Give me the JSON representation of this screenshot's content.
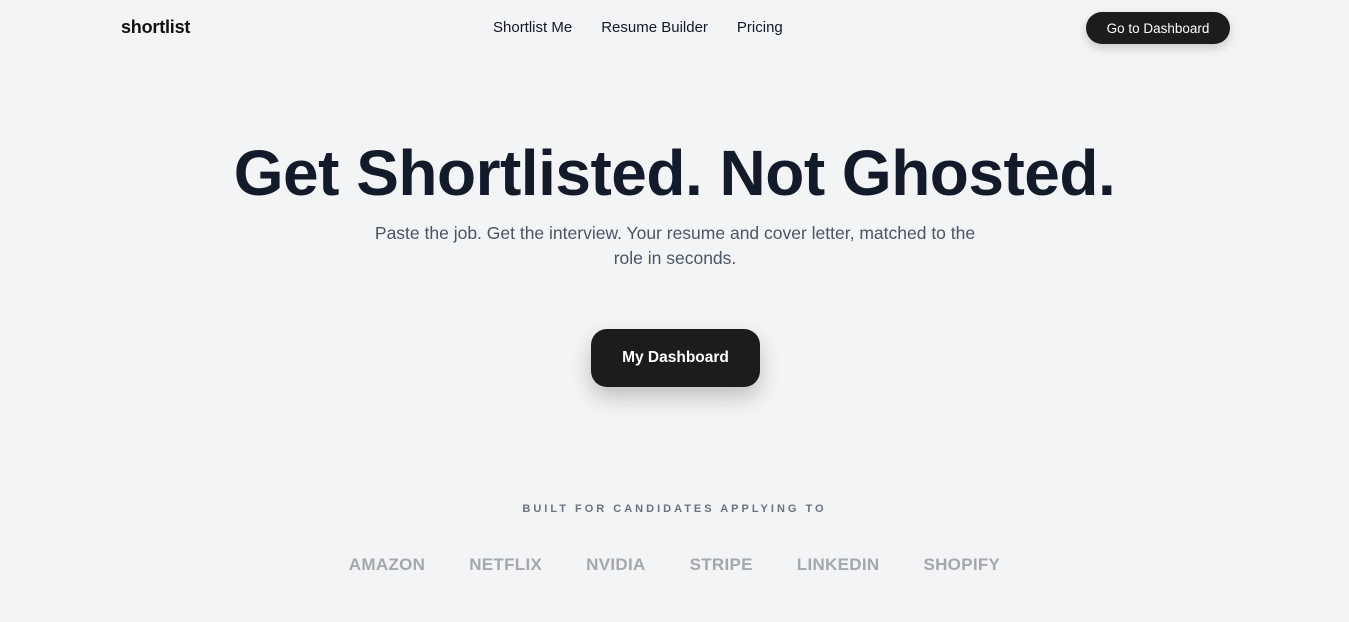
{
  "header": {
    "logo": "shortlist",
    "nav": [
      "Shortlist Me",
      "Resume Builder",
      "Pricing"
    ],
    "cta_label": "Go to Dashboard"
  },
  "hero": {
    "title": "Get Shortlisted. Not Ghosted.",
    "subtitle": "Paste the job. Get the interview. Your resume and cover letter, matched to the role in seconds.",
    "cta_label": "My Dashboard"
  },
  "trusted": {
    "label": "BUILT FOR CANDIDATES APPLYING TO",
    "companies": [
      "AMAZON",
      "NETFLIX",
      "NVIDIA",
      "STRIPE",
      "LINKEDIN",
      "SHOPIFY"
    ]
  },
  "colors": {
    "background": "#f3f4f6",
    "button": "#1c1c1e",
    "heading": "#131a2a",
    "muted_logo": "#a3a7ae"
  }
}
